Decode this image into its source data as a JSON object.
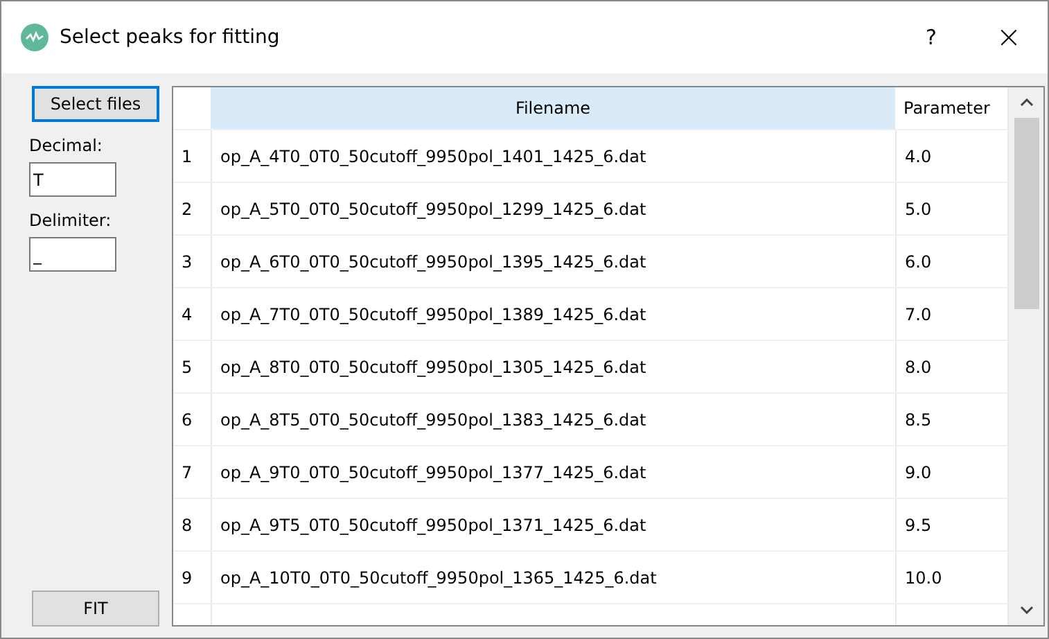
{
  "window": {
    "title": "Select peaks for fitting",
    "help": "?",
    "close": "×"
  },
  "sidebar": {
    "select_button": "Select files",
    "decimal": {
      "label": "Decimal:",
      "value": "T"
    },
    "delimiter": {
      "label": "Delimiter:",
      "value": "_"
    },
    "fit_button": "FIT"
  },
  "table": {
    "columns": [
      {
        "label": "Filename",
        "selected": true
      },
      {
        "label": "Parameter",
        "selected": false
      }
    ],
    "rows": [
      {
        "index": "1",
        "filename": "op_A_4T0_0T0_50cutoff_9950pol_1401_1425_6.dat",
        "parameter": "4.0"
      },
      {
        "index": "2",
        "filename": "op_A_5T0_0T0_50cutoff_9950pol_1299_1425_6.dat",
        "parameter": "5.0"
      },
      {
        "index": "3",
        "filename": "op_A_6T0_0T0_50cutoff_9950pol_1395_1425_6.dat",
        "parameter": "6.0"
      },
      {
        "index": "4",
        "filename": "op_A_7T0_0T0_50cutoff_9950pol_1389_1425_6.dat",
        "parameter": "7.0"
      },
      {
        "index": "5",
        "filename": "op_A_8T0_0T0_50cutoff_9950pol_1305_1425_6.dat",
        "parameter": "8.0"
      },
      {
        "index": "6",
        "filename": "op_A_8T5_0T0_50cutoff_9950pol_1383_1425_6.dat",
        "parameter": "8.5"
      },
      {
        "index": "7",
        "filename": "op_A_9T0_0T0_50cutoff_9950pol_1377_1425_6.dat",
        "parameter": "9.0"
      },
      {
        "index": "8",
        "filename": "op_A_9T5_0T0_50cutoff_9950pol_1371_1425_6.dat",
        "parameter": "9.5"
      },
      {
        "index": "9",
        "filename": "op_A_10T0_0T0_50cutoff_9950pol_1365_1425_6.dat",
        "parameter": "10.0"
      }
    ]
  }
}
